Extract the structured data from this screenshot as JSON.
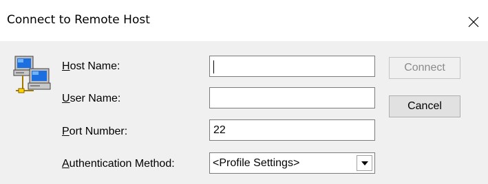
{
  "dialog": {
    "title": "Connect to Remote Host",
    "close_icon": "close-icon",
    "host_icon": "networked-computers-icon"
  },
  "form": {
    "host_name": {
      "label_mnemonic": "H",
      "label_rest": "ost Name:",
      "value": ""
    },
    "user_name": {
      "label_mnemonic": "U",
      "label_rest": "ser Name:",
      "value": ""
    },
    "port_number": {
      "label_mnemonic": "P",
      "label_rest": "ort Number:",
      "value": "22"
    },
    "auth_method": {
      "label_mnemonic": "A",
      "label_rest": "uthentication Method:",
      "selected": "<Profile Settings>",
      "arrow_icon": "chevron-down-icon"
    }
  },
  "buttons": {
    "connect": {
      "label": "Connect",
      "enabled": false
    },
    "cancel": {
      "label": "Cancel",
      "enabled": true
    }
  },
  "colors": {
    "titlebar_bg": "#ffffff",
    "dialog_bg": "#f0f0f0",
    "field_border": "#7a7a7a",
    "disabled_text": "#8a8a8a"
  }
}
